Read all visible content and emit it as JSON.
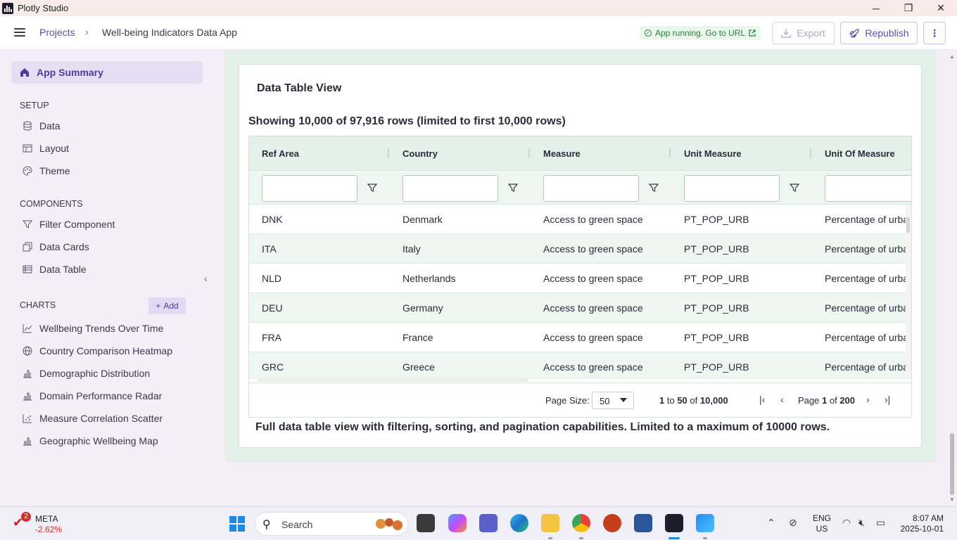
{
  "window": {
    "title": "Plotly Studio",
    "minimize": "─",
    "maximize": "❐",
    "close": "✕"
  },
  "header": {
    "breadcrumb_root": "Projects",
    "breadcrumb_sep": "›",
    "breadcrumb_current": "Well-being Indicators Data App",
    "status_text": "App running. Go to URL",
    "export_label": "Export",
    "republish_label": "Republish",
    "more_label": "⋮"
  },
  "sidebar": {
    "summary_label": "App Summary",
    "setup_label": "SETUP",
    "setup_items": [
      {
        "label": "Data",
        "icon": "database-icon"
      },
      {
        "label": "Layout",
        "icon": "layout-icon"
      },
      {
        "label": "Theme",
        "icon": "palette-icon"
      }
    ],
    "components_label": "COMPONENTS",
    "component_items": [
      {
        "label": "Filter Component",
        "icon": "filter-icon"
      },
      {
        "label": "Data Cards",
        "icon": "cards-icon"
      },
      {
        "label": "Data Table",
        "icon": "table-icon"
      }
    ],
    "charts_label": "CHARTS",
    "add_label": "Add",
    "chart_items": [
      {
        "label": "Wellbeing Trends Over Time",
        "icon": "line-chart-icon"
      },
      {
        "label": "Country Comparison Heatmap",
        "icon": "globe-icon"
      },
      {
        "label": "Demographic Distribution",
        "icon": "bar-chart-icon"
      },
      {
        "label": "Domain Performance Radar",
        "icon": "bar-chart-icon"
      },
      {
        "label": "Measure Correlation Scatter",
        "icon": "scatter-icon"
      },
      {
        "label": "Geographic Wellbeing Map",
        "icon": "bar-chart-icon"
      }
    ]
  },
  "main": {
    "card_title": "Data Table View",
    "row_info": "Showing 10,000 of 97,916 rows (limited to first 10,000 rows)",
    "footnote": "Full data table view with filtering, sorting, and pagination capabilities. Limited to a maximum of 10000 rows.",
    "columns": [
      "Ref Area",
      "Country",
      "Measure",
      "Unit Measure",
      "Unit Of Measure"
    ],
    "rows": [
      [
        "DNK",
        "Denmark",
        "Access to green space",
        "PT_POP_URB",
        "Percentage of urban population"
      ],
      [
        "ITA",
        "Italy",
        "Access to green space",
        "PT_POP_URB",
        "Percentage of urban population"
      ],
      [
        "NLD",
        "Netherlands",
        "Access to green space",
        "PT_POP_URB",
        "Percentage of urban population"
      ],
      [
        "DEU",
        "Germany",
        "Access to green space",
        "PT_POP_URB",
        "Percentage of urban population"
      ],
      [
        "FRA",
        "France",
        "Access to green space",
        "PT_POP_URB",
        "Percentage of urban population"
      ],
      [
        "GRC",
        "Greece",
        "Access to green space",
        "PT_POP_URB",
        "Percentage of urban population"
      ]
    ],
    "pager": {
      "page_size_label": "Page Size:",
      "page_size_value": "50",
      "range_from": "1",
      "range_to_word": "to",
      "range_to": "50",
      "range_of_word": "of",
      "range_total": "10,000",
      "page_word": "Page",
      "page_current": "1",
      "page_of_word": "of",
      "page_total": "200"
    }
  },
  "taskbar": {
    "stock_symbol": "META",
    "stock_change": "-2.62%",
    "stock_badge": "2",
    "search_label": "Search",
    "lang_top": "ENG",
    "lang_bottom": "US",
    "time": "8:07 AM",
    "date": "2025-10-01"
  },
  "colors": {
    "accent": "#5b4fb0",
    "grid_header": "#e4f1ea",
    "status_green": "#2e7d3e",
    "stock_red": "#d32f2f"
  }
}
